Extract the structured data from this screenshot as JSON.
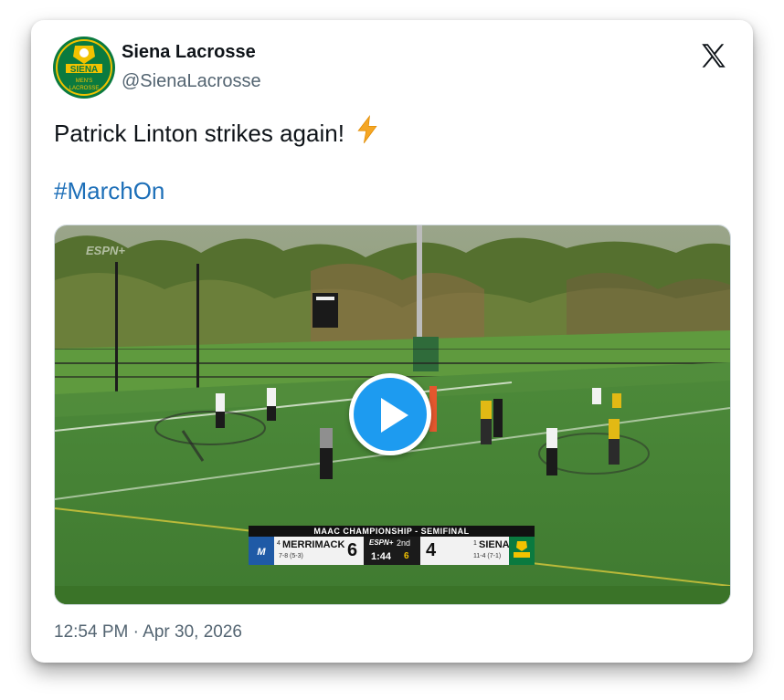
{
  "account": {
    "name": "Siena Lacrosse",
    "handle": "@SienaLacrosse",
    "avatar_text": {
      "top": "SIENA",
      "bottom1": "MEN'S",
      "bottom2": "LACROSSE"
    }
  },
  "tweet": {
    "text": "Patrick Linton strikes again!",
    "emoji_icon": "lightning-bolt",
    "hashtag": "#MarchOn",
    "timestamp": "12:54 PM · Apr 30, 2026"
  },
  "video": {
    "watermark": "ESPN+",
    "scorebug": {
      "title": "MAAC CHAMPIONSHIP - SEMIFINAL",
      "away": {
        "rank": "4",
        "name": "MERRIMACK",
        "record": "7-8 (5-3)",
        "score": "6"
      },
      "home": {
        "rank": "1",
        "name": "SIENA",
        "record": "11-4 (7-1)",
        "score": "4"
      },
      "network": "ESPN+",
      "period": "2nd",
      "clock": "1:44",
      "shot_clock": "6"
    }
  },
  "colors": {
    "siena_green": "#0a7a3f",
    "siena_gold": "#f2c200",
    "link_blue": "#1d6fb8",
    "play_blue": "#1d9bf0",
    "merrimack_blue": "#1f5aa6"
  }
}
